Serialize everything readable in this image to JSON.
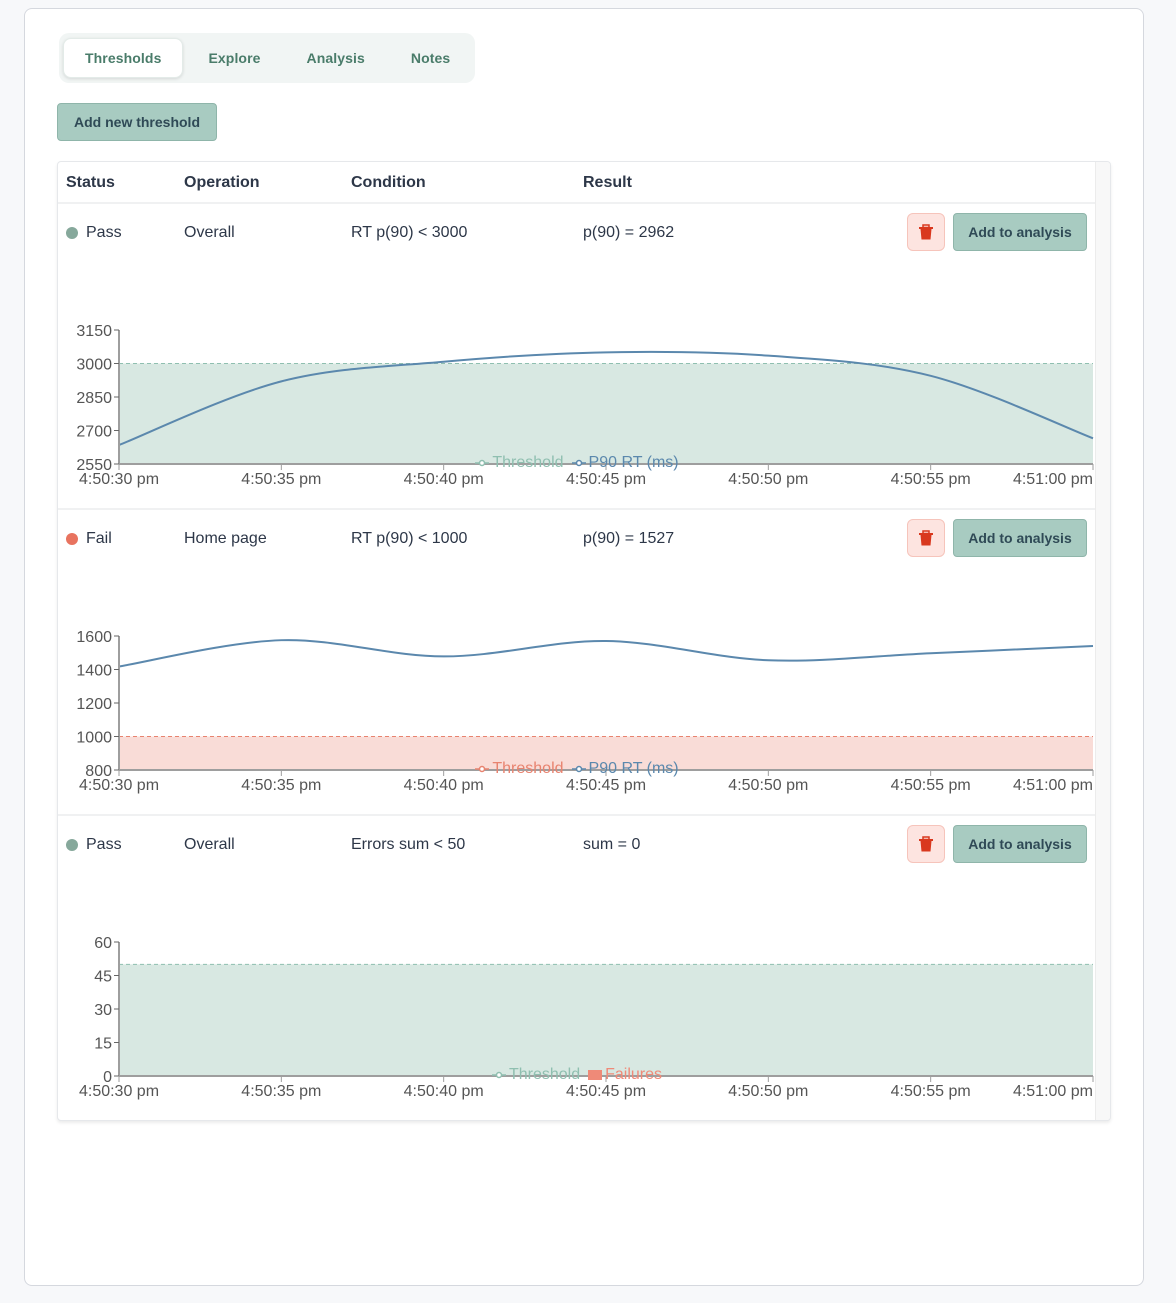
{
  "tabs": [
    {
      "label": "Thresholds",
      "active": true
    },
    {
      "label": "Explore",
      "active": false
    },
    {
      "label": "Analysis",
      "active": false
    },
    {
      "label": "Notes",
      "active": false
    }
  ],
  "toolbar": {
    "add_threshold_label": "Add new threshold"
  },
  "table": {
    "headers": {
      "status": "Status",
      "operation": "Operation",
      "condition": "Condition",
      "result": "Result"
    },
    "rows": [
      {
        "status": "Pass",
        "status_color": "#86a89b",
        "operation": "Overall",
        "condition": "RT p(90) < 3000",
        "result": "p(90) = 2962",
        "add_label": "Add to analysis",
        "delete_icon": "trash-icon"
      },
      {
        "status": "Fail",
        "status_color": "#e8735f",
        "operation": "Home page",
        "condition": "RT p(90) < 1000",
        "result": "p(90) = 1527",
        "add_label": "Add to analysis",
        "delete_icon": "trash-icon"
      },
      {
        "status": "Pass",
        "status_color": "#86a89b",
        "operation": "Overall",
        "condition": "Errors sum < 50",
        "result": "sum = 0",
        "add_label": "Add to analysis",
        "delete_icon": "trash-icon"
      }
    ]
  },
  "colors": {
    "pass_fill": "#d8e8e2",
    "pass_line": "#8fbfb0",
    "fail_fill": "#f9dcd7",
    "fail_line": "#e8836f",
    "series_line": "#5b88ad",
    "failures": "#ef8a78",
    "axis": "#9e9e9e",
    "tick_text": "#555555"
  },
  "chart_data": [
    {
      "type": "line",
      "title": "",
      "x": [
        "4:50:30 pm",
        "4:50:35 pm",
        "4:50:40 pm",
        "4:50:45 pm",
        "4:50:50 pm",
        "4:50:55 pm",
        "4:51:00 pm"
      ],
      "xlim_seconds": [
        0,
        30
      ],
      "x_seconds": [
        0,
        5,
        10,
        15,
        20,
        25,
        30
      ],
      "ylim": [
        2550,
        3150
      ],
      "yticks": [
        2550,
        2700,
        2850,
        3000,
        3150
      ],
      "threshold": 3000,
      "threshold_state": "pass",
      "series": [
        {
          "name": "P90 RT (ms)",
          "values": [
            2635,
            2920,
            3008,
            3050,
            3035,
            2945,
            2665
          ]
        }
      ],
      "legend": [
        {
          "label": "Threshold",
          "kind": "line",
          "state": "pass"
        },
        {
          "label": "P90 RT (ms)",
          "kind": "line",
          "state": "series"
        }
      ],
      "legend_position": "bottom-center"
    },
    {
      "type": "line",
      "title": "",
      "x": [
        "4:50:30 pm",
        "4:50:35 pm",
        "4:50:40 pm",
        "4:50:45 pm",
        "4:50:50 pm",
        "4:50:55 pm",
        "4:51:00 pm"
      ],
      "xlim_seconds": [
        0,
        30
      ],
      "x_seconds": [
        0,
        5,
        10,
        15,
        20,
        25,
        30
      ],
      "ylim": [
        800,
        1600
      ],
      "yticks": [
        800,
        1000,
        1200,
        1400,
        1600
      ],
      "threshold": 1000,
      "threshold_state": "fail",
      "series": [
        {
          "name": "P90 RT (ms)",
          "values": [
            1418,
            1575,
            1478,
            1570,
            1455,
            1497,
            1540
          ]
        }
      ],
      "legend": [
        {
          "label": "Threshold",
          "kind": "line",
          "state": "fail"
        },
        {
          "label": "P90 RT (ms)",
          "kind": "line",
          "state": "series"
        }
      ],
      "legend_position": "bottom-center"
    },
    {
      "type": "bar",
      "title": "",
      "x": [
        "4:50:30 pm",
        "4:50:35 pm",
        "4:50:40 pm",
        "4:50:45 pm",
        "4:50:50 pm",
        "4:50:55 pm",
        "4:51:00 pm"
      ],
      "xlim_seconds": [
        0,
        30
      ],
      "x_seconds": [
        0,
        5,
        10,
        15,
        20,
        25,
        30
      ],
      "ylim": [
        0,
        60
      ],
      "yticks": [
        0,
        15,
        30,
        45,
        60
      ],
      "threshold": 50,
      "threshold_state": "pass",
      "series": [
        {
          "name": "Failures",
          "values": [
            0,
            0,
            0,
            0,
            0,
            0,
            0
          ]
        }
      ],
      "legend": [
        {
          "label": "Threshold",
          "kind": "line",
          "state": "pass"
        },
        {
          "label": "Failures",
          "kind": "rect",
          "state": "failures"
        }
      ],
      "legend_position": "bottom-center"
    }
  ]
}
